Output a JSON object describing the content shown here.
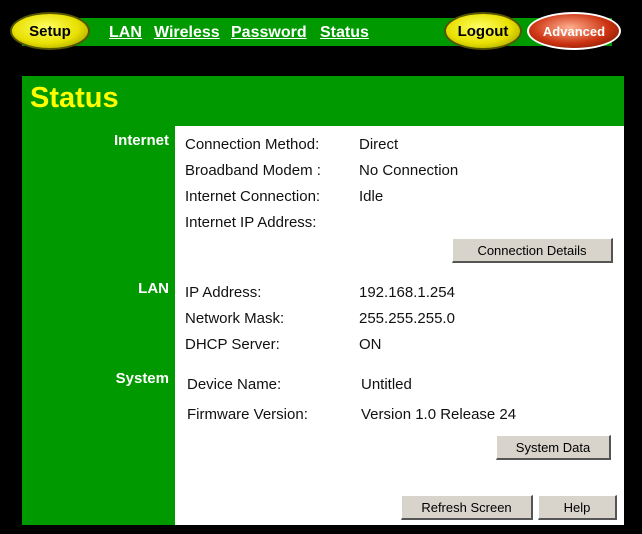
{
  "nav": {
    "setup_label": "Setup",
    "links": [
      "LAN",
      "Wireless",
      "Password",
      "Status"
    ],
    "logout_label": "Logout",
    "advanced_label": "Advanced"
  },
  "page": {
    "title": "Status"
  },
  "sections": {
    "internet": {
      "label": "Internet",
      "fields": [
        {
          "label": "Connection Method:",
          "value": "Direct"
        },
        {
          "label": "Broadband Modem :",
          "value": "No Connection"
        },
        {
          "label": "Internet Connection:",
          "value": "Idle"
        },
        {
          "label": "Internet IP Address:",
          "value": ""
        }
      ],
      "button_label": "Connection Details"
    },
    "lan": {
      "label": "LAN",
      "fields": [
        {
          "label": "IP Address:",
          "value": "192.168.1.254"
        },
        {
          "label": "Network Mask:",
          "value": "255.255.255.0"
        },
        {
          "label": "DHCP Server:",
          "value": "ON"
        }
      ]
    },
    "system": {
      "label": "System",
      "fields": [
        {
          "label": "Device Name:",
          "value": "Untitled"
        },
        {
          "label": "Firmware Version:",
          "value": "Version 1.0 Release 24"
        }
      ],
      "button_label": "System Data"
    }
  },
  "footer": {
    "refresh_label": "Refresh Screen",
    "help_label": "Help"
  },
  "colors": {
    "background": "#000000",
    "panel_green": "#009900",
    "title_yellow": "#ffff00",
    "content_white": "#ffffff"
  }
}
